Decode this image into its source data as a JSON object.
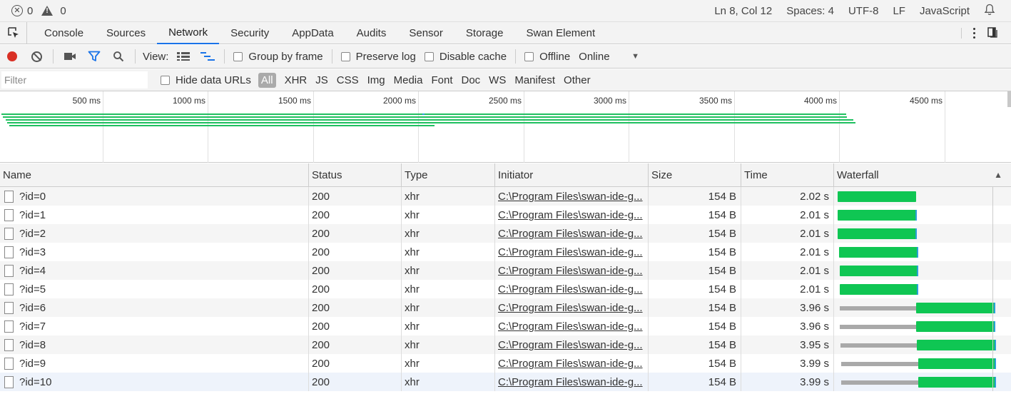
{
  "status_bar": {
    "errors": "0",
    "warnings": "0",
    "position": "Ln 8, Col 12",
    "spaces": "Spaces: 4",
    "encoding": "UTF-8",
    "eol": "LF",
    "language": "JavaScript"
  },
  "tabs": [
    "Console",
    "Sources",
    "Network",
    "Security",
    "AppData",
    "Audits",
    "Sensor",
    "Storage",
    "Swan Element"
  ],
  "active_tab": "Network",
  "toolbar": {
    "view_label": "View:",
    "group_by_frame": "Group by frame",
    "preserve_log": "Preserve log",
    "disable_cache": "Disable cache",
    "offline": "Offline",
    "throttle_value": "Online"
  },
  "filter": {
    "placeholder": "Filter",
    "hide_data_urls": "Hide data URLs",
    "types": [
      "All",
      "XHR",
      "JS",
      "CSS",
      "Img",
      "Media",
      "Font",
      "Doc",
      "WS",
      "Manifest",
      "Other"
    ]
  },
  "overview": {
    "ticks": [
      "500 ms",
      "1000 ms",
      "1500 ms",
      "2000 ms",
      "2500 ms",
      "3000 ms",
      "3500 ms",
      "4000 ms",
      "4500 ms"
    ]
  },
  "columns": [
    "Name",
    "Status",
    "Type",
    "Initiator",
    "Size",
    "Time",
    "Waterfall"
  ],
  "sort_indicator": "▲",
  "rows": [
    {
      "name": "?id=0",
      "status": "200",
      "type": "xhr",
      "initiator": "C:\\Program Files\\swan-ide-g...",
      "size": "154 B",
      "time": "2.02 s"
    },
    {
      "name": "?id=1",
      "status": "200",
      "type": "xhr",
      "initiator": "C:\\Program Files\\swan-ide-g...",
      "size": "154 B",
      "time": "2.01 s"
    },
    {
      "name": "?id=2",
      "status": "200",
      "type": "xhr",
      "initiator": "C:\\Program Files\\swan-ide-g...",
      "size": "154 B",
      "time": "2.01 s"
    },
    {
      "name": "?id=3",
      "status": "200",
      "type": "xhr",
      "initiator": "C:\\Program Files\\swan-ide-g...",
      "size": "154 B",
      "time": "2.01 s"
    },
    {
      "name": "?id=4",
      "status": "200",
      "type": "xhr",
      "initiator": "C:\\Program Files\\swan-ide-g...",
      "size": "154 B",
      "time": "2.01 s"
    },
    {
      "name": "?id=5",
      "status": "200",
      "type": "xhr",
      "initiator": "C:\\Program Files\\swan-ide-g...",
      "size": "154 B",
      "time": "2.01 s"
    },
    {
      "name": "?id=6",
      "status": "200",
      "type": "xhr",
      "initiator": "C:\\Program Files\\swan-ide-g...",
      "size": "154 B",
      "time": "3.96 s"
    },
    {
      "name": "?id=7",
      "status": "200",
      "type": "xhr",
      "initiator": "C:\\Program Files\\swan-ide-g...",
      "size": "154 B",
      "time": "3.96 s"
    },
    {
      "name": "?id=8",
      "status": "200",
      "type": "xhr",
      "initiator": "C:\\Program Files\\swan-ide-g...",
      "size": "154 B",
      "time": "3.95 s"
    },
    {
      "name": "?id=9",
      "status": "200",
      "type": "xhr",
      "initiator": "C:\\Program Files\\swan-ide-g...",
      "size": "154 B",
      "time": "3.99 s"
    },
    {
      "name": "?id=10",
      "status": "200",
      "type": "xhr",
      "initiator": "C:\\Program Files\\swan-ide-g...",
      "size": "154 B",
      "time": "3.99 s"
    }
  ],
  "colors": {
    "accent": "#1a73e8",
    "record": "#d93025",
    "waterfall_receive": "#0fc653",
    "waterfall_wait": "#a9a9a9",
    "waterfall_tip": "#2aa1d8"
  }
}
